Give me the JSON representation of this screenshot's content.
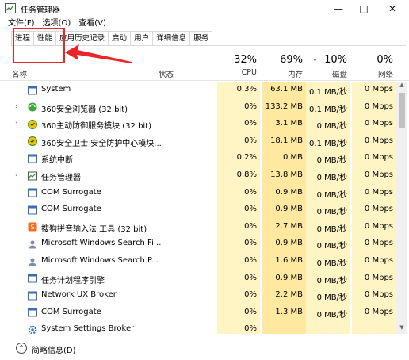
{
  "window": {
    "title": "任务管理器"
  },
  "menu": [
    "文件(F)",
    "选项(O)",
    "查看(V)"
  ],
  "tabs": [
    "进程",
    "性能",
    "应用历史记录",
    "启动",
    "用户",
    "详细信息",
    "服务"
  ],
  "active_tab": 0,
  "columns": {
    "name": "名称",
    "status": "状态",
    "cpu": {
      "pct": "32%",
      "label": "CPU"
    },
    "memory": {
      "pct": "69%",
      "label": "内存"
    },
    "disk": {
      "pct": "10%",
      "label": "磁盘"
    },
    "network": {
      "pct": "0%",
      "label": "网络"
    }
  },
  "processes": [
    {
      "name": "System",
      "expandable": false,
      "icon": "window-icon",
      "cpu": "0.3%",
      "mem": "63.1 MB",
      "disk": "0.1 MB/秒",
      "net": "0 Mbps"
    },
    {
      "name": "360安全浏览器 (32 bit)",
      "expandable": true,
      "icon": "360-browser-icon",
      "cpu": "0%",
      "mem": "133.2 MB",
      "disk": "0.1 MB/秒",
      "net": "0 Mbps"
    },
    {
      "name": "360主动防御服务模块 (32 bit)",
      "expandable": true,
      "icon": "360-shield-icon",
      "cpu": "0%",
      "mem": "3.1 MB",
      "disk": "0 MB/秒",
      "net": "0 Mbps"
    },
    {
      "name": "360安全卫士 安全防护中心模块...",
      "expandable": false,
      "icon": "360-shield-icon",
      "cpu": "0%",
      "mem": "18.1 MB",
      "disk": "0.1 MB/秒",
      "net": "0 Mbps"
    },
    {
      "name": "系统中断",
      "expandable": false,
      "icon": "window-icon",
      "cpu": "0.2%",
      "mem": "0 MB",
      "disk": "0 MB/秒",
      "net": "0 Mbps"
    },
    {
      "name": "任务管理器",
      "expandable": true,
      "icon": "task-manager-icon",
      "cpu": "0.8%",
      "mem": "13.8 MB",
      "disk": "0 MB/秒",
      "net": "0 Mbps"
    },
    {
      "name": "COM Surrogate",
      "expandable": false,
      "icon": "window-icon",
      "cpu": "0%",
      "mem": "0.9 MB",
      "disk": "0 MB/秒",
      "net": "0 Mbps"
    },
    {
      "name": "COM Surrogate",
      "expandable": false,
      "icon": "window-icon",
      "cpu": "0%",
      "mem": "0.9 MB",
      "disk": "0 MB/秒",
      "net": "0 Mbps"
    },
    {
      "name": "搜狗拼音输入法 工具 (32 bit)",
      "expandable": false,
      "icon": "sogou-icon",
      "cpu": "0%",
      "mem": "2.7 MB",
      "disk": "0 MB/秒",
      "net": "0 Mbps"
    },
    {
      "name": "Microsoft Windows Search Fi...",
      "expandable": false,
      "icon": "search-indexer-icon",
      "cpu": "0%",
      "mem": "0.9 MB",
      "disk": "0 MB/秒",
      "net": "0 Mbps"
    },
    {
      "name": "Microsoft Windows Search P...",
      "expandable": false,
      "icon": "search-indexer-icon",
      "cpu": "0%",
      "mem": "1.6 MB",
      "disk": "0 MB/秒",
      "net": "0 Mbps"
    },
    {
      "name": "任务计划程序引擎",
      "expandable": false,
      "icon": "window-icon",
      "cpu": "0%",
      "mem": "0.9 MB",
      "disk": "0 MB/秒",
      "net": "0 Mbps"
    },
    {
      "name": "Network UX Broker",
      "expandable": false,
      "icon": "window-icon",
      "cpu": "0%",
      "mem": "2.2 MB",
      "disk": "0 MB/秒",
      "net": "0 Mbps"
    },
    {
      "name": "COM Surrogate",
      "expandable": false,
      "icon": "window-icon",
      "cpu": "0%",
      "mem": "1.3 MB",
      "disk": "0 MB/秒",
      "net": "0 Mbps"
    },
    {
      "name": "System Settings Broker",
      "expandable": false,
      "icon": "gear-icon",
      "cpu": "0%",
      "mem": "",
      "disk": "",
      "net": ""
    }
  ],
  "footer": {
    "label": "简略信息(D)"
  },
  "colors": {
    "cell_light": "#fff4c4",
    "cell_mid": "#ffe9a0",
    "annotation": "#e8262a"
  }
}
